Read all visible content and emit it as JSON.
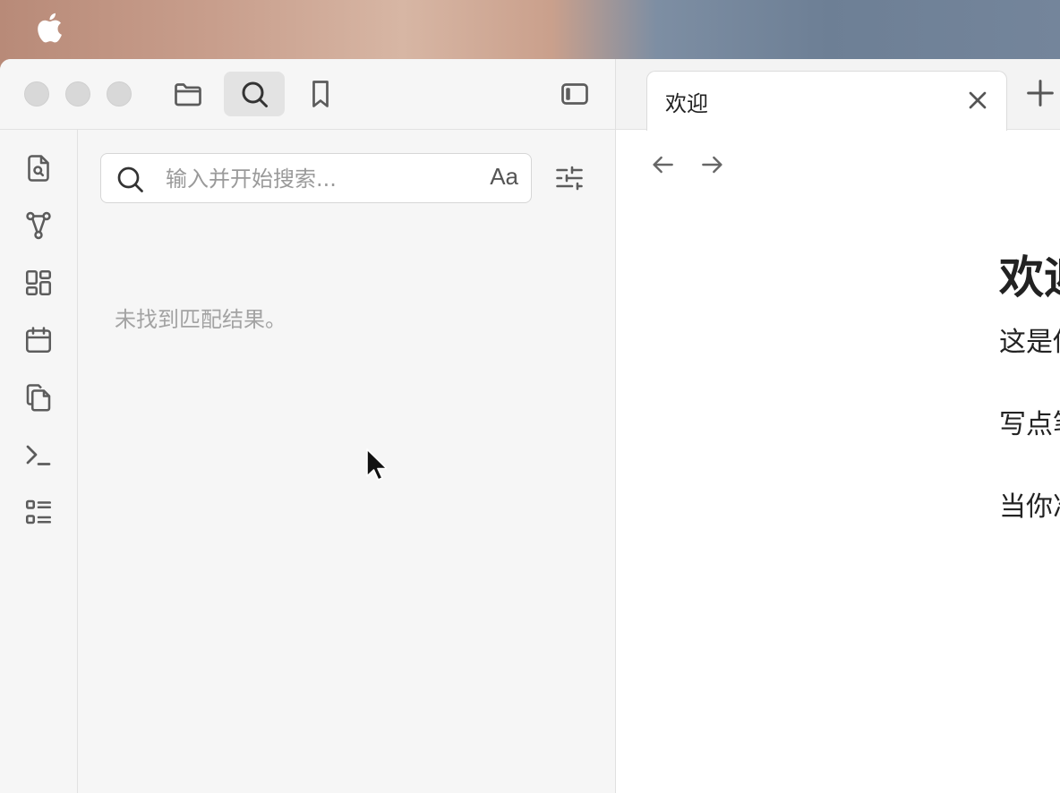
{
  "colors": {
    "accent_active_bg": "#e3e3e3",
    "icon": "#5c5c5c",
    "muted_text": "#a3a3a3"
  },
  "toolbar": {
    "buttons": [
      {
        "icon": "folder-icon"
      },
      {
        "icon": "search-icon",
        "active": true
      },
      {
        "icon": "bookmark-icon"
      },
      {
        "icon": "sidebar-toggle-icon"
      }
    ]
  },
  "ribbon": {
    "icons": [
      "file-search-icon",
      "graph-icon",
      "canvas-icon",
      "calendar-icon",
      "copy-icon",
      "terminal-icon",
      "list-icon"
    ]
  },
  "search": {
    "placeholder": "输入并开始搜索...",
    "value": "",
    "case_label": "Aa",
    "no_results": "未找到匹配结果。"
  },
  "tabs": [
    {
      "title": "欢迎"
    }
  ],
  "document": {
    "title": "欢迎",
    "paragraphs": [
      "这是你",
      "写点笔",
      "当你准"
    ]
  }
}
